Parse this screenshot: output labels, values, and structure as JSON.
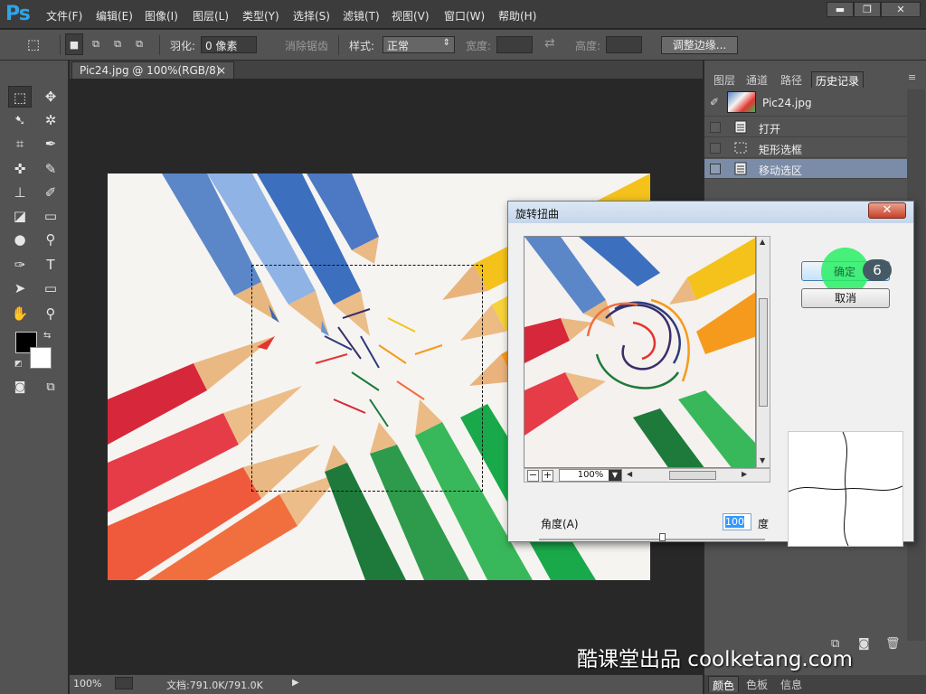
{
  "app": {
    "logo": "Ps"
  },
  "menu": [
    "文件(F)",
    "编辑(E)",
    "图像(I)",
    "图层(L)",
    "类型(Y)",
    "选择(S)",
    "滤镜(T)",
    "视图(V)",
    "窗口(W)",
    "帮助(H)"
  ],
  "window_controls": {
    "minimize": "▬",
    "restore": "❐",
    "close": "✕"
  },
  "options_bar": {
    "feather_label": "羽化:",
    "feather_value": "0 像素",
    "antialias_label": "消除锯齿",
    "style_label": "样式:",
    "style_value": "正常",
    "width_label": "宽度:",
    "height_label": "高度:",
    "refine_edge_button": "调整边缘..."
  },
  "document": {
    "tab_title": "Pic24.jpg @ 100%(RGB/8) *",
    "tab_close": "×"
  },
  "status_bar": {
    "zoom": "100%",
    "doc_info": "文档:791.0K/791.0K"
  },
  "right_panel": {
    "tabs": [
      "图层",
      "通道",
      "路径",
      "历史记录"
    ],
    "active_tab": "历史记录",
    "snapshot_name": "Pic24.jpg",
    "history_items": [
      "打开",
      "矩形选框",
      "移动选区"
    ],
    "selected_item": "移动选区",
    "bottom_tabs": [
      "颜色",
      "色板",
      "信息"
    ]
  },
  "dialog": {
    "title": "旋转扭曲",
    "close": "✕",
    "ok_label": "确定",
    "cancel_label": "取消",
    "zoom_value": "100%",
    "zoom_minus": "−",
    "zoom_plus": "+",
    "angle_label": "角度(A)",
    "angle_value": "100",
    "angle_unit": "度",
    "step_number": "6"
  },
  "watermark": "酷课堂出品 coolketang.com",
  "colors": {
    "accent": "#2fa4e7",
    "selected_row": "#7a8ca8",
    "highlight": "#28f064"
  }
}
